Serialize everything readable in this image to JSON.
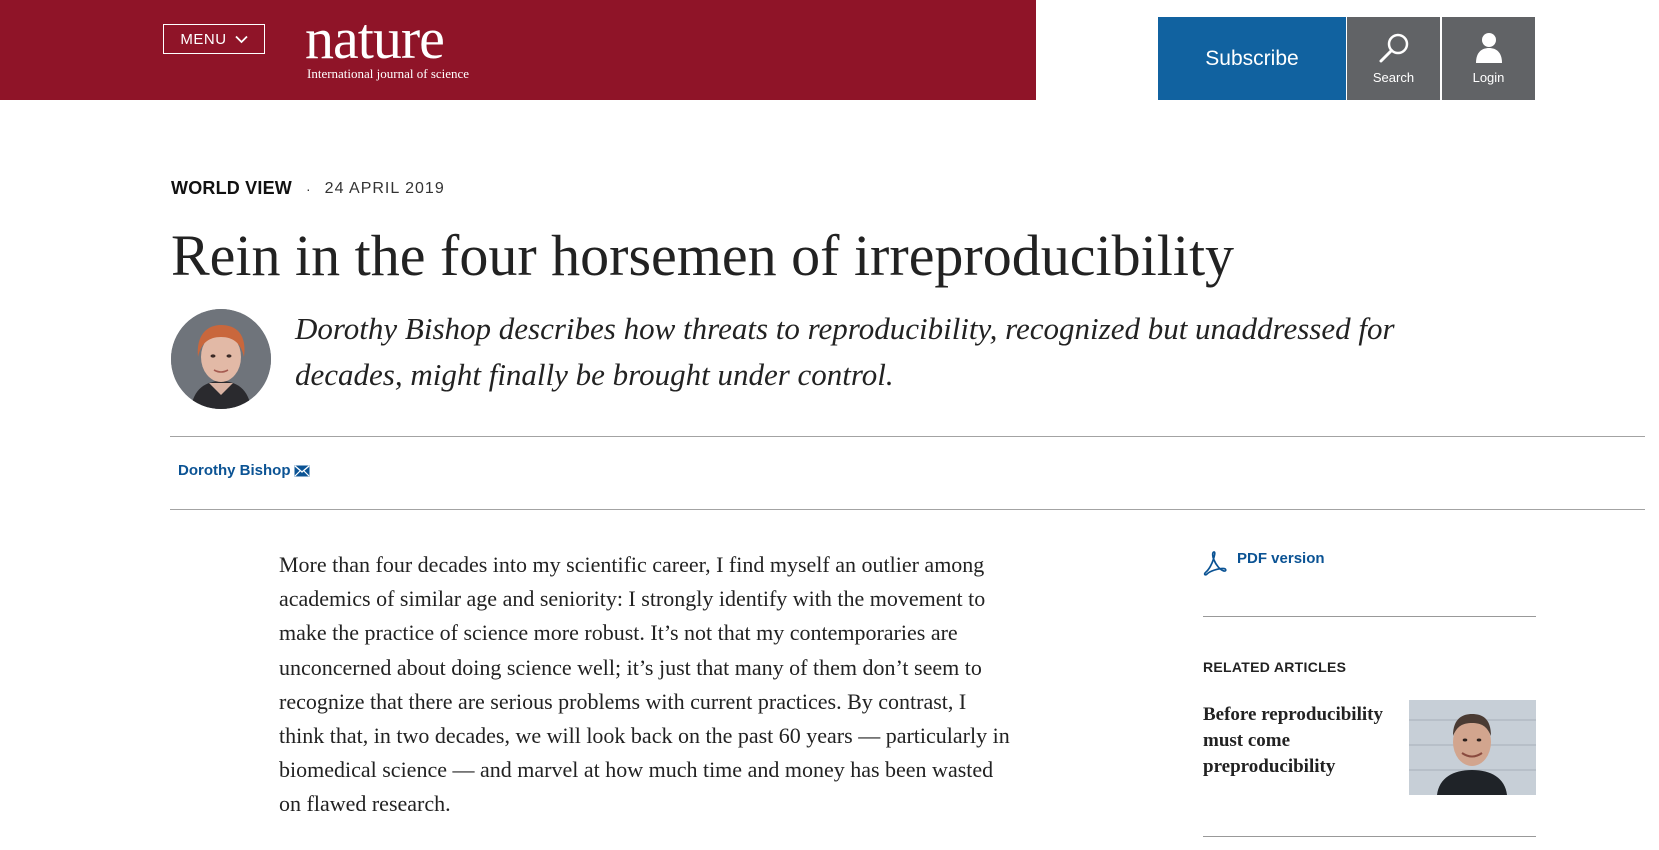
{
  "header": {
    "menu_label": "MENU",
    "logo_word": "nature",
    "logo_tagline": "International journal of science",
    "subscribe_label": "Subscribe",
    "search_label": "Search",
    "login_label": "Login",
    "brand_color": "#8f1428",
    "subscribe_color": "#1162a0"
  },
  "article": {
    "type": "WORLD VIEW",
    "separator": "·",
    "date": "24 APRIL 2019",
    "title": "Rein in the four horsemen of irreproducibility",
    "standfirst": "Dorothy Bishop describes how threats to reproducibility, recognized but unaddressed for decades, might finally be brought under control.",
    "author": "Dorothy Bishop",
    "body": "More than four decades into my scientific career, I find myself an outlier among academics of similar age and seniority: I strongly identify with the movement to make the practice of science more robust. It’s not that my contemporaries are unconcerned about doing science well; it’s just that many of them don’t seem to recognize that there are serious problems with current practices. By contrast, I think that, in two decades, we will look back on the past 60 years — particularly in biomedical science — and marvel at how much time and money has been wasted on flawed research."
  },
  "sidebar": {
    "pdf_label": "PDF version",
    "related_heading": "RELATED ARTICLES",
    "related": [
      {
        "title": "Before reproducibility must come preproducibility"
      }
    ]
  }
}
